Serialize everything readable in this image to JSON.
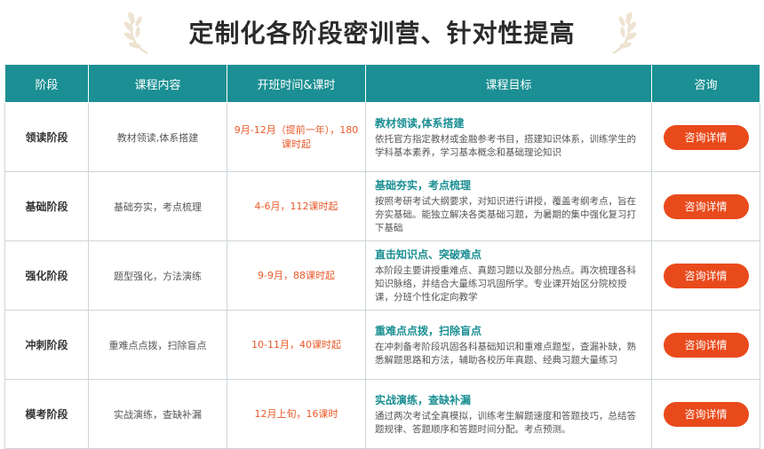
{
  "header": {
    "title": "定制化各阶段密训营、针对性提高"
  },
  "table": {
    "columns": [
      "阶段",
      "课程内容",
      "开班时间&课时",
      "课程目标",
      "咨询"
    ],
    "rows": [
      {
        "stage": "领读阶段",
        "content": "教材领读,体系搭建",
        "time": "9月-12月（提前一年），180课时起",
        "goal_title": "教材领读,体系搭建",
        "goal_desc": "依托官方指定教材或金融参考书目，搭建知识体系，训练学生的学科基本素养，学习基本概念和基础理论知识",
        "button": "咨询详情"
      },
      {
        "stage": "基础阶段",
        "content": "基础夯实，考点梳理",
        "time": "4-6月，112课时起",
        "goal_title": "基础夯实，考点梳理",
        "goal_desc": "按照考研考试大纲要求，对知识进行讲授，覆盖考纲考点，旨在夯实基础。能独立解决各类基础习题，为暑期的集中强化复习打下基础",
        "button": "咨询详情"
      },
      {
        "stage": "强化阶段",
        "content": "题型强化，方法演练",
        "time": "9-9月，88课时起",
        "goal_title": "直击知识点、突破难点",
        "goal_desc": "本阶段主要讲授重难点、真题习题以及部分热点。再次梳理各科知识脉络，并结合大量练习巩固所学。专业课开始区分院校授课，分班个性化定向教学",
        "button": "咨询详情"
      },
      {
        "stage": "冲刺阶段",
        "content": "重难点点拨，扫除盲点",
        "time": "10-11月，40课时起",
        "goal_title": "重难点点拨，扫除盲点",
        "goal_desc": "在冲刺备考阶段巩固各科基础知识和重难点题型，查漏补缺，熟悉解题思路和方法，辅助各校历年真题、经典习题大量练习",
        "button": "咨询详情"
      },
      {
        "stage": "模考阶段",
        "content": "实战演练，查缺补漏",
        "time": "12月上旬，16课时",
        "goal_title": "实战演练，查缺补漏",
        "goal_desc": "通过两次考试全真模拟，训练考生解题速度和答题技巧，总结答题规律、答题顺序和答题时间分配。考点预测。",
        "button": "咨询详情"
      }
    ]
  },
  "colors": {
    "header_bg": "#1b8f93",
    "button_bg": "#e94a1c",
    "accent_text": "#e85a2a"
  },
  "icons": {
    "decoration": "laurel-icon"
  }
}
